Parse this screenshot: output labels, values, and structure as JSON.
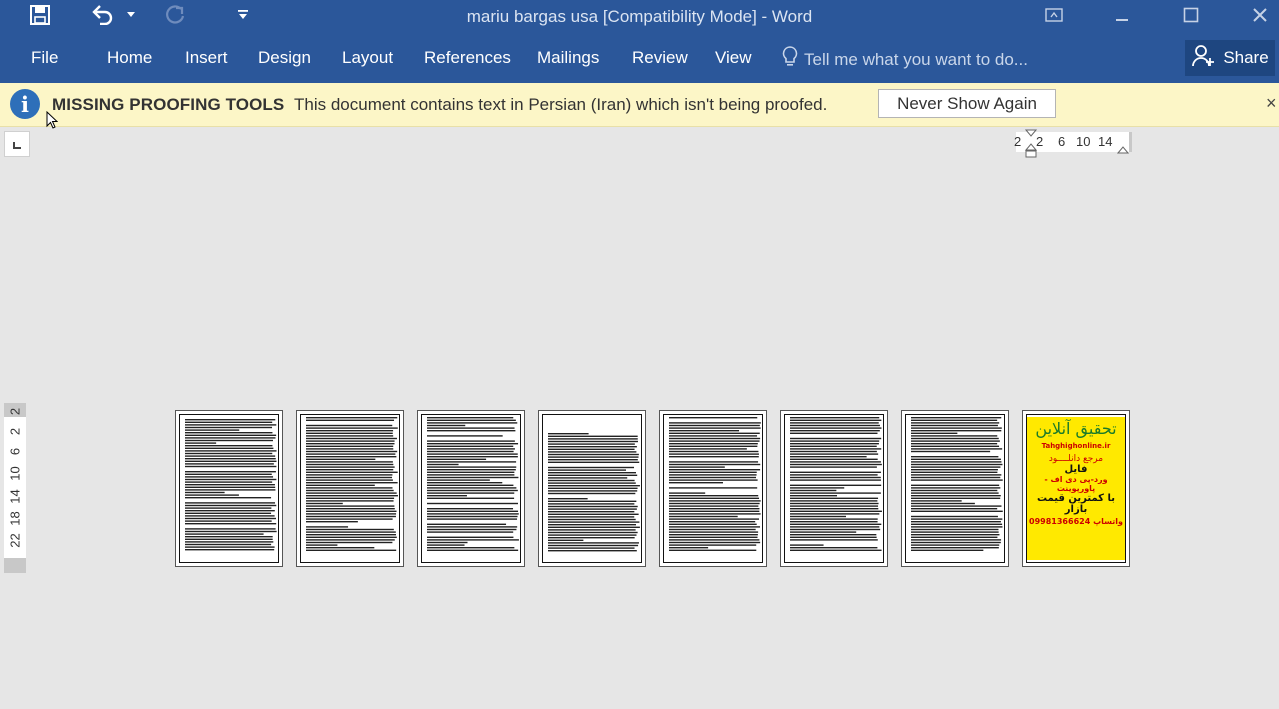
{
  "window": {
    "title": "mariu bargas usa [Compatibility Mode] - Word"
  },
  "ribbon": {
    "tabs": [
      "File",
      "Home",
      "Insert",
      "Design",
      "Layout",
      "References",
      "Mailings",
      "Review",
      "View"
    ],
    "tell_me": "Tell me what you want to do...",
    "share": "Share"
  },
  "message_bar": {
    "title": "MISSING PROOFING TOOLS",
    "text": "This document contains text in Persian (Iran) which isn't being proofed.",
    "button": "Never Show Again",
    "close": "×"
  },
  "hruler": {
    "labels": [
      "2",
      "2",
      "6",
      "10",
      "14"
    ]
  },
  "vruler": {
    "labels": [
      "2",
      "2",
      "6",
      "10",
      "14",
      "18",
      "22"
    ]
  },
  "pages": {
    "count": 8
  },
  "ad": {
    "heading": "تحقیق آنلاین",
    "site": "Tahghighonline.ir",
    "line1": "مرجع دانلــــود",
    "line2": "فایل",
    "line3": "ورد-پی دی اف - پاورپوینت",
    "line4": "با کمترین قیمت بازار",
    "phone": "09981366624",
    "phone_label": "واتساپ"
  },
  "colors": {
    "ribbon": "#2b579a",
    "message_bar": "#fcf6c7",
    "canvas": "#e6e6e6",
    "ad_background": "#ffe900"
  }
}
